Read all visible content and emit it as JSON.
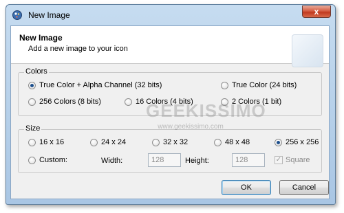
{
  "window": {
    "title": "New Image",
    "close_label": "x"
  },
  "header": {
    "title": "New Image",
    "subtitle": "Add a new image to your icon"
  },
  "colors": {
    "label": "Colors",
    "options": [
      {
        "label": "True Color + Alpha Channel (32 bits)",
        "checked": true
      },
      {
        "label": "True Color (24 bits)",
        "checked": false
      },
      {
        "label": "256 Colors (8 bits)",
        "checked": false
      },
      {
        "label": "16 Colors (4 bits)",
        "checked": false
      },
      {
        "label": "2 Colors (1 bit)",
        "checked": false
      }
    ]
  },
  "size": {
    "label": "Size",
    "options": [
      {
        "label": "16 x 16",
        "checked": false
      },
      {
        "label": "24 x 24",
        "checked": false
      },
      {
        "label": "32 x 32",
        "checked": false
      },
      {
        "label": "48 x 48",
        "checked": false
      },
      {
        "label": "256 x 256",
        "checked": true
      }
    ],
    "custom_label": "Custom:",
    "width_label": "Width:",
    "width_value": "128",
    "height_label": "Height:",
    "height_value": "128",
    "square_label": "Square",
    "square_checked": true
  },
  "buttons": {
    "ok": "OK",
    "cancel": "Cancel"
  },
  "watermark": {
    "main": "GEEKISSIMO",
    "url": "www.geekissimo.com"
  },
  "icons": {
    "app": "paint-palette-icon",
    "close": "close-icon"
  },
  "colors_theme": {
    "accent": "#1d4f8c",
    "titlebar": "#b9d1ea",
    "close": "#c7432a"
  }
}
